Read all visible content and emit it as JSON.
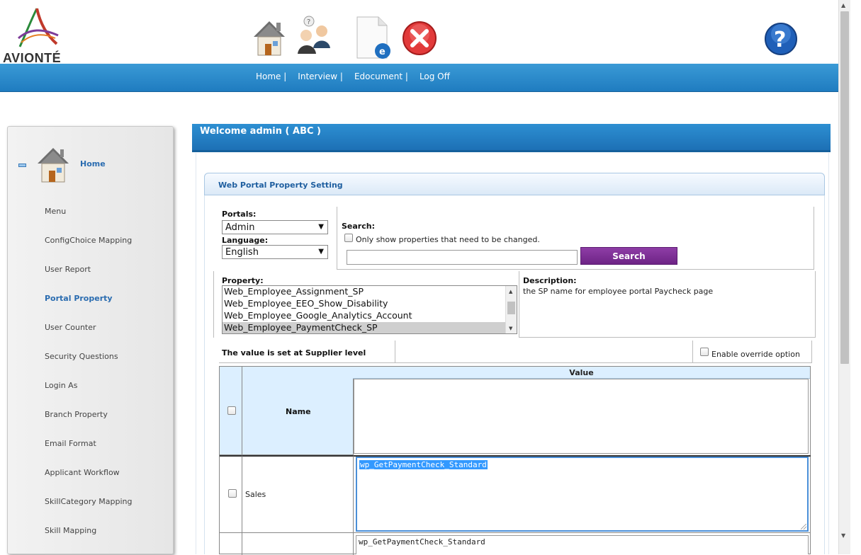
{
  "brand": {
    "logo_text": "AVIONTÉ"
  },
  "toolbar": {
    "icons": [
      "home-icon",
      "interview-icon",
      "edocument-icon",
      "logoff-icon",
      "help-icon"
    ]
  },
  "nav": {
    "links": [
      "Home |",
      "Interview |",
      "Edocument |",
      "Log Off"
    ]
  },
  "sidebar": {
    "home_label": "Home",
    "items": [
      "Menu",
      "ConfigChoice Mapping",
      "User Report",
      "Portal Property",
      "User Counter",
      "Security Questions",
      "Login As",
      "Branch Property",
      "Email Format",
      "Applicant Workflow",
      "SkillCategory Mapping",
      "Skill Mapping"
    ],
    "active_item": "Portal Property"
  },
  "welcome": {
    "text": "Welcome admin ( ABC )"
  },
  "settings": {
    "title": "Web Portal Property Setting",
    "portals_label": "Portals:",
    "portals_value": "Admin",
    "language_label": "Language:",
    "language_value": "English",
    "search_label": "Search:",
    "only_changed_label": "Only show properties that need to be changed.",
    "search_value": "",
    "search_button": "Search",
    "property_label": "Property:",
    "properties": [
      "Web_Employee_Assignment_SP",
      "Web_Employee_EEO_Show_Disability",
      "Web_Employee_Google_Analytics_Account",
      "Web_Employee_PaymentCheck_SP"
    ],
    "selected_property": "Web_Employee_PaymentCheck_SP",
    "description_label": "Description:",
    "description_text": "the SP name for employee portal Paycheck page",
    "level_text": "The value is set at Supplier level",
    "override_label": "Enable override option"
  },
  "grid": {
    "col_name": "Name",
    "col_value": "Value",
    "header_value": "",
    "rows": [
      {
        "name": "Sales",
        "value": "wp_GetPaymentCheck_Standard"
      },
      {
        "name": "",
        "value": "wp_GetPaymentCheck_Standard"
      }
    ]
  }
}
